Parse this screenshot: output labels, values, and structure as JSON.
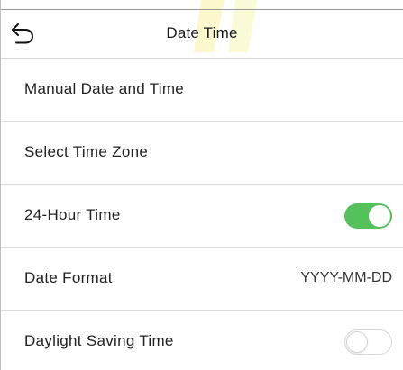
{
  "header": {
    "title": "Date Time",
    "back_icon": "back-arrow-icon"
  },
  "rows": [
    {
      "label": "Manual Date and Time"
    },
    {
      "label": "Select Time Zone"
    },
    {
      "label": "24-Hour Time",
      "toggle": true
    },
    {
      "label": "Date Format",
      "value": "YYYY-MM-DD"
    },
    {
      "label": "Daylight Saving Time",
      "toggle": false
    }
  ],
  "colors": {
    "toggle_on": "#55c15a",
    "watermark": "#f5f0a0"
  }
}
